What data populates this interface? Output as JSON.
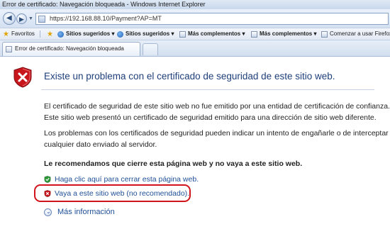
{
  "window": {
    "title": "Error de certificado: Navegación bloqueada - Windows Internet Explorer"
  },
  "address_bar": {
    "url": "https://192.168.88.10/Payment?AP=MT"
  },
  "favorites_bar": {
    "items": [
      {
        "label": "Favoritos",
        "icon": "star-icon"
      },
      {
        "label": "Sitios sugeridos ▾",
        "icon": "ie-icon"
      },
      {
        "label": "Sitios sugeridos ▾",
        "icon": "ie-icon"
      },
      {
        "label": "Más complementos ▾",
        "icon": "page-icon"
      },
      {
        "label": "Más complementos ▾",
        "icon": "page-icon"
      },
      {
        "label": "Comenzar a usar Firefox",
        "icon": "page-icon"
      }
    ]
  },
  "tabs": [
    {
      "label": "Error de certificado: Navegación bloqueada"
    }
  ],
  "page": {
    "headline": "Existe un problema con el certificado de seguridad de este sitio web.",
    "paragraph1": [
      "El certificado de seguridad de este sitio web no fue emitido por una entidad de certificación de confianza.",
      "Este sitio web presentó un certificado de seguridad emitido para una dirección de sitio web diferente."
    ],
    "paragraph2": [
      "Los problemas con los certificados de seguridad pueden indicar un intento de engañarle o de interceptar",
      "cualquier dato enviado al servidor."
    ],
    "recommendation": "Le recomendamos que cierre esta página web y no vaya a este sitio web.",
    "close_link": "Haga clic aquí para cerrar esta página web.",
    "continue_link": "Vaya a este sitio web (no recomendado).",
    "more_info": "Más información"
  },
  "colors": {
    "headline": "#1f3f7a",
    "link": "#1f4f96",
    "highlight": "#d2151c",
    "shield_red": "#c8161d"
  }
}
